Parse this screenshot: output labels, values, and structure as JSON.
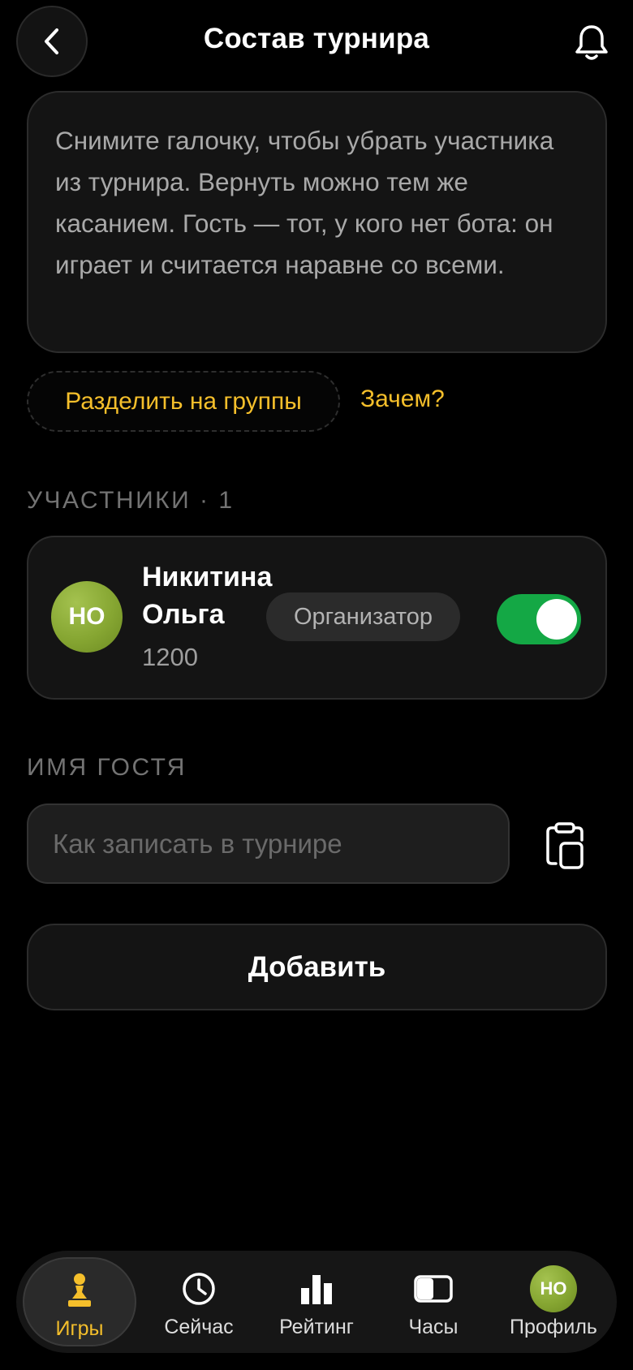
{
  "header": {
    "title": "Состав турнира",
    "back_icon": "chevron-left-icon",
    "bell_icon": "bell-icon"
  },
  "info": {
    "text": "Снимите галочку, чтобы убрать участника из турнира. Вернуть можно тем же касанием. Гость — тот, у кого нет бота: он играет и считается наравне со всеми."
  },
  "groups": {
    "split_label": "Разделить на группы",
    "why_label": "Зачем?"
  },
  "participants": {
    "section_label": "УЧАСТНИКИ · 1",
    "items": [
      {
        "initials": "НО",
        "name": "Никитина Ольга",
        "rating": "1200",
        "role": "Организатор",
        "included": true
      }
    ]
  },
  "guest": {
    "section_label": "ИМЯ ГОСТЯ",
    "value": "",
    "placeholder": "Как записать в турнире",
    "paste_icon": "clipboard-icon",
    "add_label": "Добавить"
  },
  "nav": {
    "items": [
      {
        "label": "Игры",
        "icon": "pawn-icon",
        "active": true
      },
      {
        "label": "Сейчас",
        "icon": "clock-icon",
        "active": false
      },
      {
        "label": "Рейтинг",
        "icon": "bar-chart-icon",
        "active": false
      },
      {
        "label": "Часы",
        "icon": "chess-clock-icon",
        "active": false
      },
      {
        "label": "Профиль",
        "icon": "avatar",
        "initials": "НО",
        "active": false
      }
    ]
  },
  "colors": {
    "accent": "#f5bf2b",
    "toggle_on": "#14a845",
    "avatar": "#86a632",
    "background": "#000000",
    "card": "#141414"
  }
}
